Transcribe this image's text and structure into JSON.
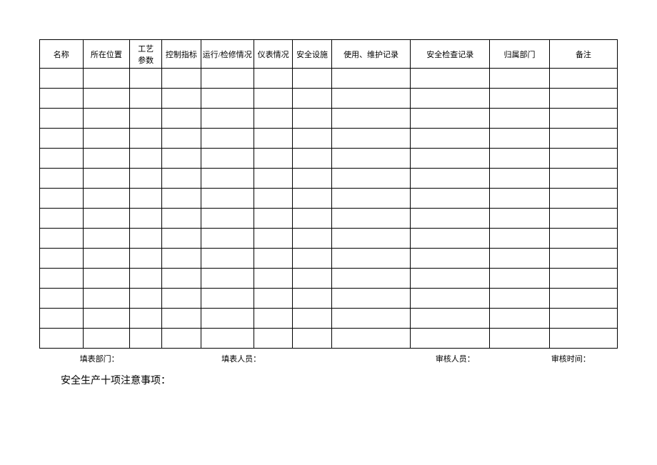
{
  "table": {
    "headers": [
      "名称",
      "所在位置",
      "工艺\n参数",
      "控制指标",
      "运行/检修情况",
      "仪表情况",
      "安全设施",
      "使用、维护记录",
      "安全检查记录",
      "归属部门",
      "备注"
    ],
    "rowCount": 14
  },
  "footer": {
    "dept_label": "填表部门：",
    "filler_label": "填表人员：",
    "reviewer_label": "审核人员：",
    "review_time_label": "审核时间："
  },
  "note": "安全生产十项注意事项："
}
